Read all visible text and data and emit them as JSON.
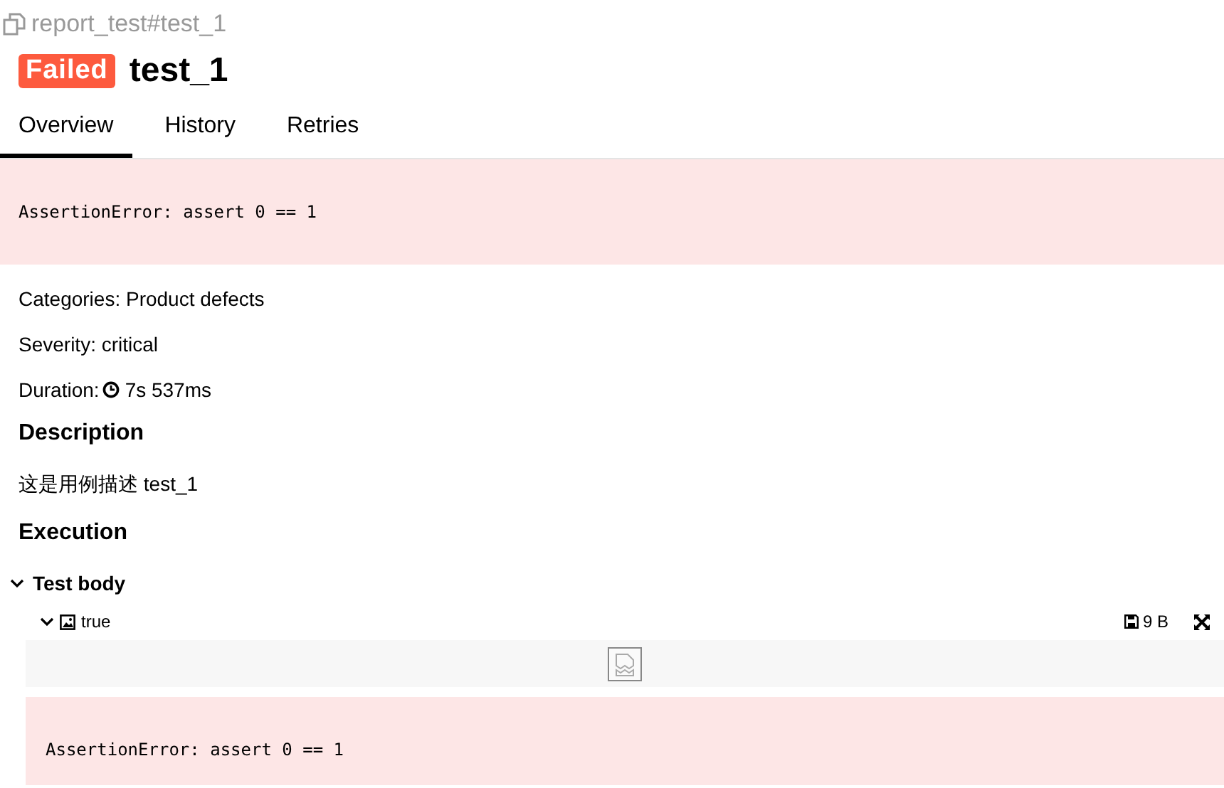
{
  "path": "report_test#test_1",
  "status": {
    "label": "Failed",
    "color": "#fd5a3e"
  },
  "title": "test_1",
  "tabs": [
    {
      "label": "Overview",
      "selected": true
    },
    {
      "label": "History",
      "selected": false
    },
    {
      "label": "Retries",
      "selected": false
    }
  ],
  "error": "AssertionError: assert 0 == 1",
  "fields": [
    {
      "label": "Categories: ",
      "value": "Product defects"
    },
    {
      "label": "Severity: ",
      "value": "critical"
    }
  ],
  "duration": {
    "label": "Duration: ",
    "value": "7s 537ms"
  },
  "description": {
    "heading": "Description",
    "text": "这是用例描述 test_1"
  },
  "execution": {
    "heading": "Execution",
    "step": {
      "name": "Test body",
      "expanded": true,
      "attachment": {
        "name": "true",
        "expanded": true,
        "size": "9 B"
      }
    },
    "error": "AssertionError: assert 0 == 1"
  }
}
